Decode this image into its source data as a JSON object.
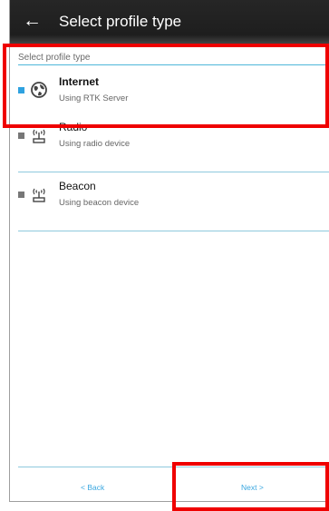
{
  "header": {
    "back_glyph": "←",
    "title": "Select profile type"
  },
  "list": {
    "subheader": "Select profile type",
    "items": [
      {
        "name": "Internet",
        "description": "Using RTK Server",
        "icon": "globe-icon",
        "selected": true
      },
      {
        "name": "Radio",
        "description": "Using radio device",
        "icon": "antenna-icon",
        "selected": false
      },
      {
        "name": "Beacon",
        "description": "Using beacon device",
        "icon": "antenna-icon",
        "selected": false
      }
    ]
  },
  "footer": {
    "back_label": "< Back",
    "next_label": "Next >"
  },
  "colors": {
    "accent": "#2fa2e0",
    "highlight": "#ef0000",
    "appbar": "#1e1e1e"
  }
}
